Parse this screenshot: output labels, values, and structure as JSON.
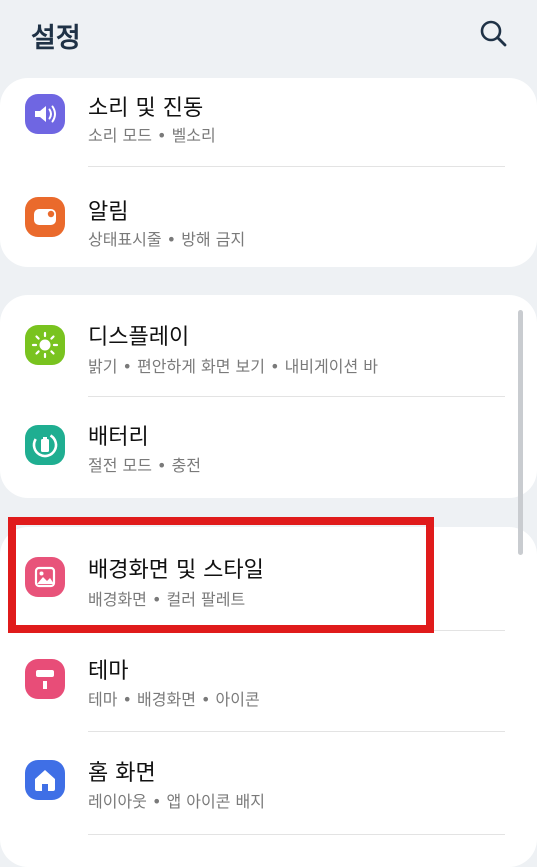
{
  "header": {
    "title": "설정"
  },
  "groups": [
    {
      "items": [
        {
          "label": "소리 및 진동",
          "sub": "소리 모드 • 벨소리",
          "icon": "speaker-icon",
          "color": "#6f66e2"
        },
        {
          "label": "알림",
          "sub": "상태표시줄 • 방해 금지",
          "icon": "notification-icon",
          "color": "#ea6a2c"
        }
      ]
    },
    {
      "items": [
        {
          "label": "디스플레이",
          "sub": "밝기 • 편안하게 화면 보기 • 내비게이션 바",
          "icon": "sun-icon",
          "color": "#79c31f"
        },
        {
          "label": "배터리",
          "sub": "절전 모드 • 충전",
          "icon": "battery-icon",
          "color": "#1fae91"
        }
      ]
    },
    {
      "items": [
        {
          "label": "배경화면 및 스타일",
          "sub": "배경화면 • 컬러 팔레트",
          "icon": "image-icon",
          "color": "#e8537a"
        },
        {
          "label": "테마",
          "sub": "테마 • 배경화면 • 아이콘",
          "icon": "paint-roller-icon",
          "color": "#e84d78"
        },
        {
          "label": "홈 화면",
          "sub": "레이아웃 • 앱 아이콘 배지",
          "icon": "home-icon",
          "color": "#3f6fe6"
        }
      ]
    }
  ],
  "highlight_color": "#e01b1b"
}
